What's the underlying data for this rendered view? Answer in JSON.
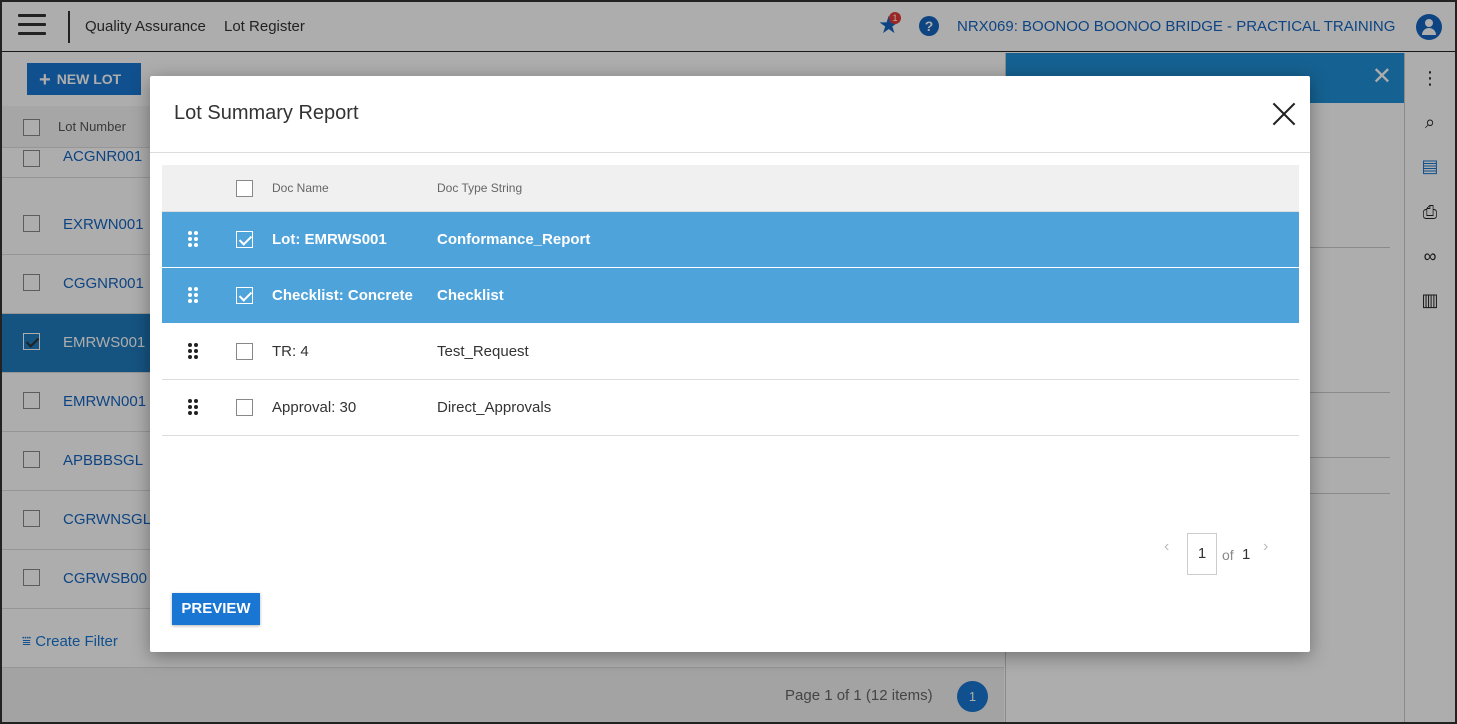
{
  "header": {
    "breadcrumb_module": "Quality Assurance",
    "breadcrumb_page": "Lot Register",
    "favorites_badge": "1",
    "help_label": "?",
    "project_name": "NRX069: BOONOO BOONOO BRIDGE - PRACTICAL TRAINING"
  },
  "background": {
    "new_lot_label": "NEW LOT",
    "column_lot_number": "Lot Number",
    "lots": [
      {
        "lot": "ACGNR001",
        "selected": false
      },
      {
        "lot": "EXRWN001",
        "selected": false
      },
      {
        "lot": "CGGNR001",
        "selected": false
      },
      {
        "lot": "EMRWS001",
        "selected": true
      },
      {
        "lot": "EMRWN001",
        "selected": false
      },
      {
        "lot": "APBBBSGL",
        "selected": false
      },
      {
        "lot": "CGRWNSGL",
        "selected": false
      },
      {
        "lot": "CGRWSB00",
        "selected": false
      }
    ],
    "create_filter_label": "Create Filter",
    "page_info": "Page 1 of 1 (12 items)",
    "current_page": "1"
  },
  "modal": {
    "title": "Lot Summary Report",
    "columns": {
      "doc_name": "Doc Name",
      "doc_type": "Doc Type String"
    },
    "rows": [
      {
        "doc_name": "Lot: EMRWS001",
        "doc_type": "Conformance_Report",
        "checked": true
      },
      {
        "doc_name": "Checklist: Concrete",
        "doc_type": "Checklist",
        "checked": true
      },
      {
        "doc_name": "TR: 4",
        "doc_type": "Test_Request",
        "checked": false
      },
      {
        "doc_name": "Approval: 30",
        "doc_type": "Direct_Approvals",
        "checked": false
      }
    ],
    "pager": {
      "current": "1",
      "of_label": "of",
      "total": "1"
    },
    "preview_label": "PREVIEW"
  },
  "colors": {
    "accent": "#1976d2",
    "selected_row": "#4fa3db",
    "link": "#1565c0"
  }
}
